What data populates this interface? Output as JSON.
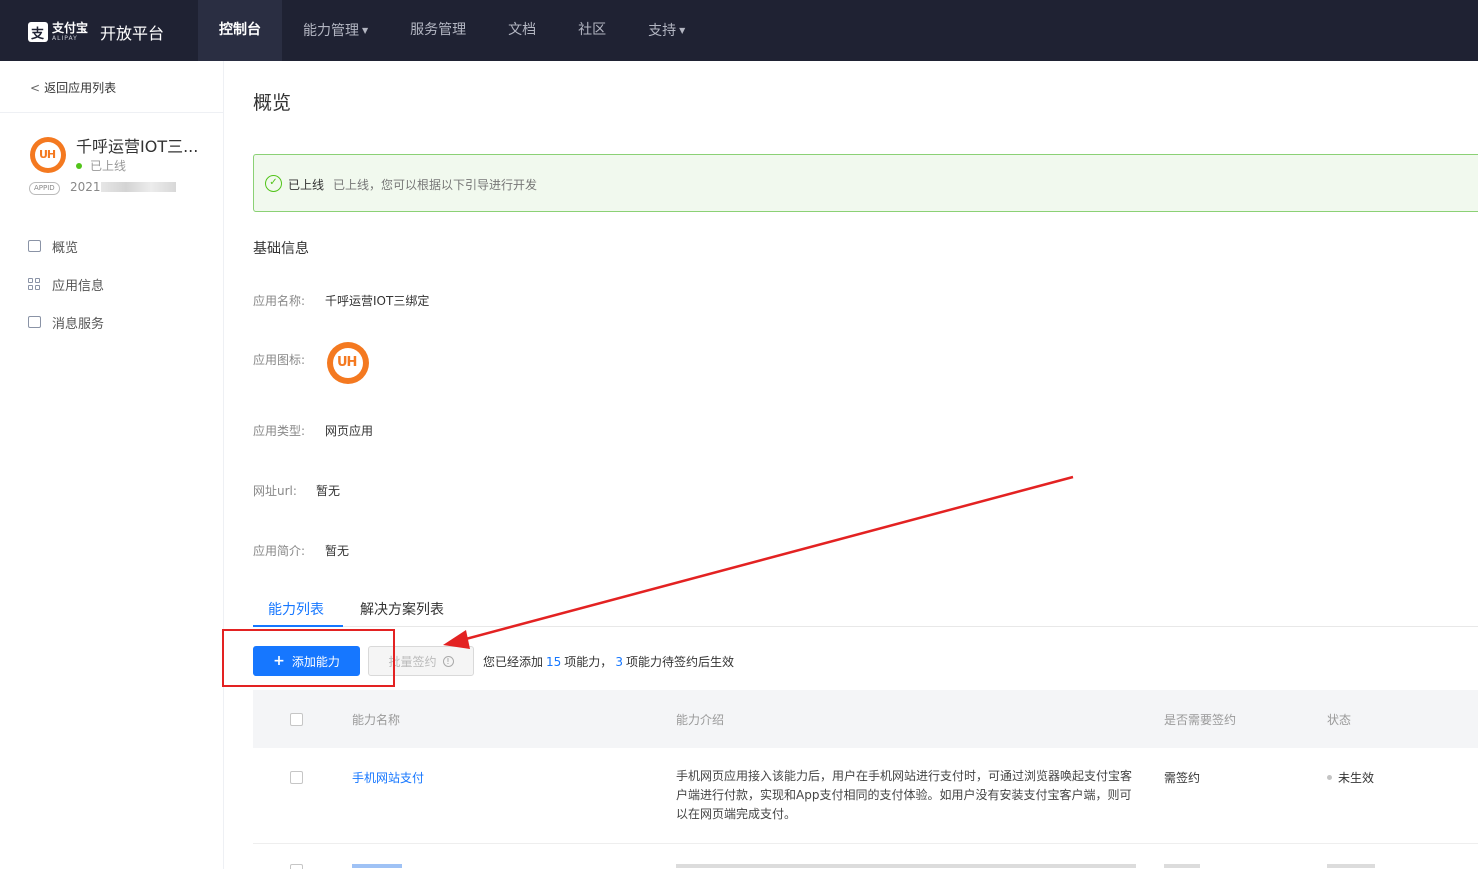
{
  "brand": {
    "logo_cn": "支付宝",
    "logo_en": "ALIPAY",
    "title": "开放平台"
  },
  "nav": {
    "items": [
      {
        "label": "控制台",
        "active": true
      },
      {
        "label": "能力管理",
        "dropdown": true
      },
      {
        "label": "服务管理"
      },
      {
        "label": "文档"
      },
      {
        "label": "社区"
      },
      {
        "label": "支持",
        "dropdown": true
      }
    ]
  },
  "sidebar": {
    "back_label": "返回应用列表",
    "app_name": "千呼运营IOT三...",
    "app_status": "已上线",
    "appid_badge": "APPID",
    "appid_prefix": "2021",
    "menu": [
      {
        "label": "概览",
        "icon": "chart-icon"
      },
      {
        "label": "应用信息",
        "icon": "grid-icon"
      },
      {
        "label": "消息服务",
        "icon": "message-icon"
      }
    ]
  },
  "page": {
    "title": "概览"
  },
  "alert": {
    "title": "已上线",
    "description": "已上线，您可以根据以下引导进行开发"
  },
  "basic_info": {
    "section_title": "基础信息",
    "name_label": "应用名称:",
    "name_value": "千呼运营IOT三绑定",
    "icon_label": "应用图标:",
    "type_label": "应用类型:",
    "type_value": "网页应用",
    "url_label": "网址url:",
    "url_value": "暂无",
    "intro_label": "应用简介:",
    "intro_value": "暂无"
  },
  "tabs": [
    {
      "label": "能力列表",
      "active": true
    },
    {
      "label": "解决方案列表"
    }
  ],
  "toolbar": {
    "add_label": "添加能力",
    "batch_label": "批量签约",
    "summary_prefix": "您已经添加",
    "added_count": "15",
    "summary_mid": "项能力，",
    "pending_count": "3",
    "summary_suffix": "项能力待签约后生效"
  },
  "table": {
    "headers": [
      "能力名称",
      "能力介绍",
      "是否需要签约",
      "状态"
    ],
    "rows": [
      {
        "name": "手机网站支付",
        "description": "手机网页应用接入该能力后，用户在手机网站进行支付时，可通过浏览器唤起支付宝客户端进行付款，实现和App支付相同的支付体验。如用户没有安装支付宝客户端，则可以在网页端完成支付。",
        "sign": "需签约",
        "status": "未生效"
      }
    ]
  },
  "colors": {
    "nav_bg": "#1f2233",
    "accent": "#1677ff",
    "success": "#52c41a",
    "annotation": "#e32222"
  }
}
